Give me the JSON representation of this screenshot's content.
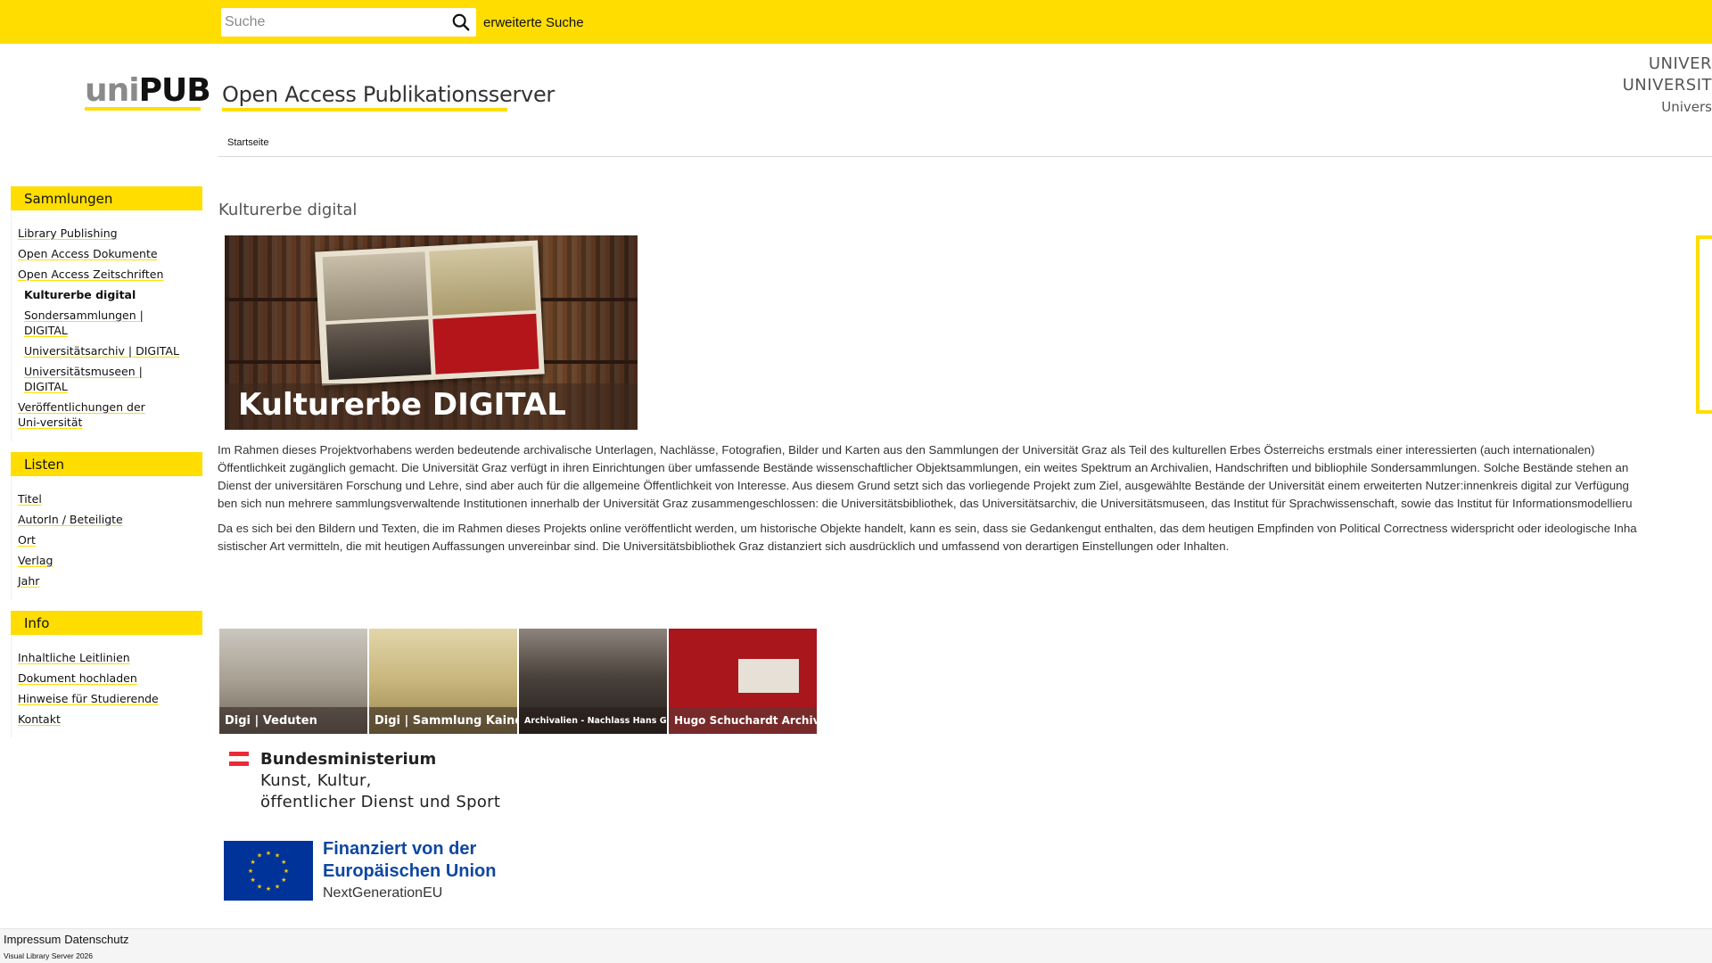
{
  "topbar": {
    "search_placeholder": "Suche",
    "advanced_search": "erweiterte Suche"
  },
  "header": {
    "logo_uni": "uni",
    "logo_pub": "PUB",
    "site_title": "Open Access Publikationsserver",
    "university_line1": "UNIVER",
    "university_line2": "UNIVERSIT",
    "university_line3": "Univers",
    "breadcrumb": "Startseite"
  },
  "sidebar": {
    "sections": [
      {
        "title": "Sammlungen",
        "items": [
          {
            "label": "Library Publishing",
            "sub": false,
            "active": false
          },
          {
            "label": "Open Access Dokumente",
            "sub": false,
            "active": false
          },
          {
            "label": "Open Access Zeitschriften",
            "sub": false,
            "active": false
          },
          {
            "label": "Kulturerbe digital",
            "sub": true,
            "active": true
          },
          {
            "label": "Sondersammlungen | DIGITAL",
            "sub": true,
            "active": false
          },
          {
            "label": "Universitätsarchiv | DIGITAL",
            "sub": true,
            "active": false
          },
          {
            "label": "Universitätsmuseen | DIGITAL",
            "sub": true,
            "active": false
          },
          {
            "label": "Veröffentlichungen der Uni-versität",
            "sub": false,
            "active": false
          }
        ]
      },
      {
        "title": "Listen",
        "items": [
          {
            "label": "Titel",
            "sub": false,
            "active": false
          },
          {
            "label": "AutorIn / Beteiligte",
            "sub": false,
            "active": false
          },
          {
            "label": "Ort",
            "sub": false,
            "active": false
          },
          {
            "label": "Verlag",
            "sub": false,
            "active": false
          },
          {
            "label": "Jahr",
            "sub": false,
            "active": false
          }
        ]
      },
      {
        "title": "Info",
        "items": [
          {
            "label": "Inhaltliche Leitlinien",
            "sub": false,
            "active": false
          },
          {
            "label": "Dokument hochladen",
            "sub": false,
            "active": false
          },
          {
            "label": "Hinweise für Studierende",
            "sub": false,
            "active": false
          },
          {
            "label": "Kontakt",
            "sub": false,
            "active": false
          }
        ]
      }
    ]
  },
  "main": {
    "page_title": "Kulturerbe digital",
    "banner_text": "Kulturerbe DIGITAL",
    "intro_paragraphs": [
      "Im Rahmen dieses Projektvorhabens werden bedeutende archivalische Unterlagen, Nachlässe, Fotografien, Bilder und Karten aus den Sammlungen der Universität Graz als Teil des kulturellen Erbes Österreichs erstmals einer interessierten (auch internationalen) Öffentlichkeit zugänglich gemacht. Die Universität Graz verfügt in ihren Einrichtungen über umfassende Bestände wissenschaftlicher Objektsammlungen, ein weites Spektrum an Archivalien, Handschriften und bibliophile Sondersammlungen. Solche Bestände stehen an Dienst der universitären Forschung und Lehre, sind aber auch für die allgemeine Öffentlichkeit von Interesse. Aus diesem Grund setzt sich das vorliegende Projekt zum Ziel, ausgewählte Bestände der Universität einem erweiterten Nutzer:innenkreis digital zur Verfügung ben sich nun mehrere sammlungsverwaltende Institutionen innerhalb der Universität Graz zusammengeschlossen: die Universitätsbibliothek, das Universitätsarchiv, die Universitätsmuseen, das Institut für Sprachwissenschaft, sowie das Institut für Informationsmodellieru",
      "Da es sich bei den Bildern und Texten, die im Rahmen dieses Projekts online veröffentlicht werden, um historische Objekte handelt, kann es sein, dass sie Gedankengut enthalten, das dem heutigen Empfinden von Political Correctness widerspricht oder ideologische Inha sistischer Art vermitteln, die mit heutigen Auffassungen unvereinbar sind. Die Universitätsbibliothek Graz distanziert sich ausdrücklich und umfassend von derartigen Einstellungen oder Inhalten."
    ],
    "intro_lines": [
      "Im Rahmen dieses Projektvorhabens werden bedeutende archivalische Unterlagen, Nachlässe, Fotografien, Bilder und Karten aus den Sammlungen der Universität Graz als Teil des kulturellen Erbes Österreichs erstmals einer interessierten (auch internationalen)",
      "Öffentlichkeit zugänglich gemacht. Die Universität Graz verfügt in ihren Einrichtungen über umfassende Bestände wissenschaftlicher Objektsammlungen, ein weites Spektrum an Archivalien, Handschriften und bibliophile Sondersammlungen. Solche Bestände stehen an",
      "Dienst der universitären Forschung und Lehre, sind aber auch für die allgemeine Öffentlichkeit von Interesse. Aus diesem Grund setzt sich das vorliegende Projekt zum Ziel, ausgewählte Bestände der Universität einem erweiterten Nutzer:innenkreis digital zur Verfügung",
      "ben sich nun mehrere sammlungsverwaltende Institutionen innerhalb der Universität Graz zusammengeschlossen: die Universitätsbibliothek, das Universitätsarchiv, die Universitätsmuseen, das Institut für Sprachwissenschaft, sowie das Institut für Informationsmodellieru"
    ],
    "notice_lines": [
      "Da es sich bei den Bildern und Texten, die im Rahmen dieses Projekts online veröffentlicht werden, um historische Objekte handelt, kann es sein, dass sie Gedankengut enthalten, das dem heutigen Empfinden von Political Correctness widerspricht oder ideologische Inha",
      "sistischer Art vermitteln, die mit heutigen Auffassungen unvereinbar sind. Die Universitätsbibliothek Graz distanziert sich ausdrücklich und umfassend von derartigen Einstellungen oder Inhalten."
    ],
    "tiles": [
      {
        "label": "Digi | Veduten"
      },
      {
        "label": "Digi | Sammlung Kaindl"
      },
      {
        "label": "Archivalien - Nachlass Hans Gross"
      },
      {
        "label": "Hugo Schuchardt Archiv"
      }
    ],
    "ministry": {
      "line1": "Bundesministerium",
      "line2": "Kunst, Kultur,",
      "line3": "öffentlicher Dienst und Sport"
    },
    "eu": {
      "title_line1": "Finanziert von der",
      "title_line2": "Europäischen Union",
      "subtitle": "NextGenerationEU"
    }
  },
  "footer": {
    "impressum": "Impressum",
    "datenschutz": "Datenschutz",
    "copyright": "Visual Library Server 2026"
  },
  "colors": {
    "brand_yellow": "#ffdd00",
    "eu_blue": "#003399",
    "eu_star": "#ffcc00",
    "austria_red": "#ed2939"
  }
}
